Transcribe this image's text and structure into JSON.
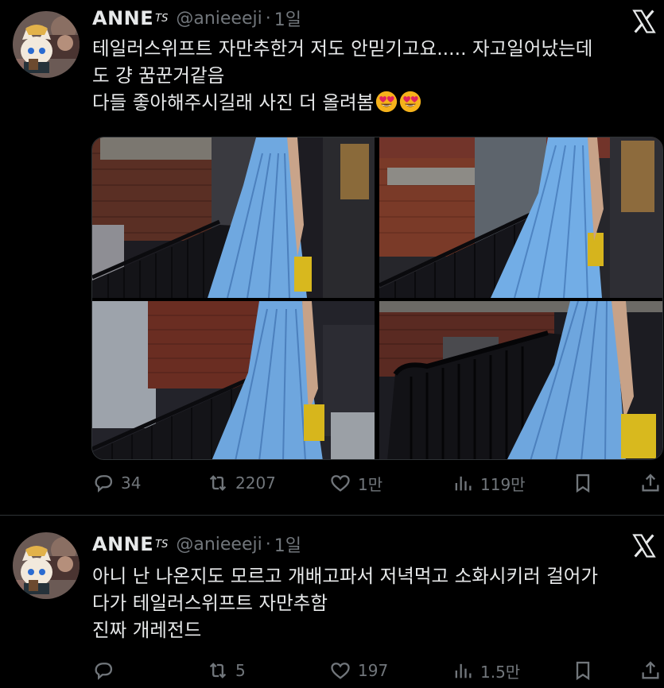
{
  "tweets": [
    {
      "author": {
        "name": "ANNE",
        "name_suffix": "TS",
        "handle": "@anieeeji",
        "separator": "·",
        "time": "1일"
      },
      "text_lines": [
        "테일러스위프트 자만추한거 저도 안믿기고요..... 자고일어났는데",
        "도 걍 꿈꾼거같음",
        "다들 좋아해주시길래 사진 더 올려봄"
      ],
      "emojis": [
        "heart-eyes-emoji",
        "heart-eyes-emoji"
      ],
      "stats": {
        "replies": "34",
        "reposts": "2207",
        "likes": "1만",
        "views": "119만"
      }
    },
    {
      "author": {
        "name": "ANNE",
        "name_suffix": "TS",
        "handle": "@anieeeji",
        "separator": "·",
        "time": "1일"
      },
      "text_lines": [
        "아니 난 나온지도 모르고 개배고파서 저녁먹고 소화시키러 걸어가",
        "다가 테일러스위프트 자만추함",
        "진짜 개레전드"
      ],
      "stats": {
        "replies": "",
        "reposts": "5",
        "likes": "197",
        "views": "1.5만"
      }
    }
  ],
  "icons": {
    "platform": "x-logo-icon",
    "reply": "reply-icon",
    "repost": "repost-icon",
    "like": "heart-icon",
    "views": "views-icon",
    "bookmark": "bookmark-icon",
    "share": "share-icon"
  },
  "colors": {
    "background": "#000000",
    "text": "#e7e9ea",
    "muted": "#71767b",
    "divider": "#2f3336",
    "dress": "#6fa8e0"
  }
}
